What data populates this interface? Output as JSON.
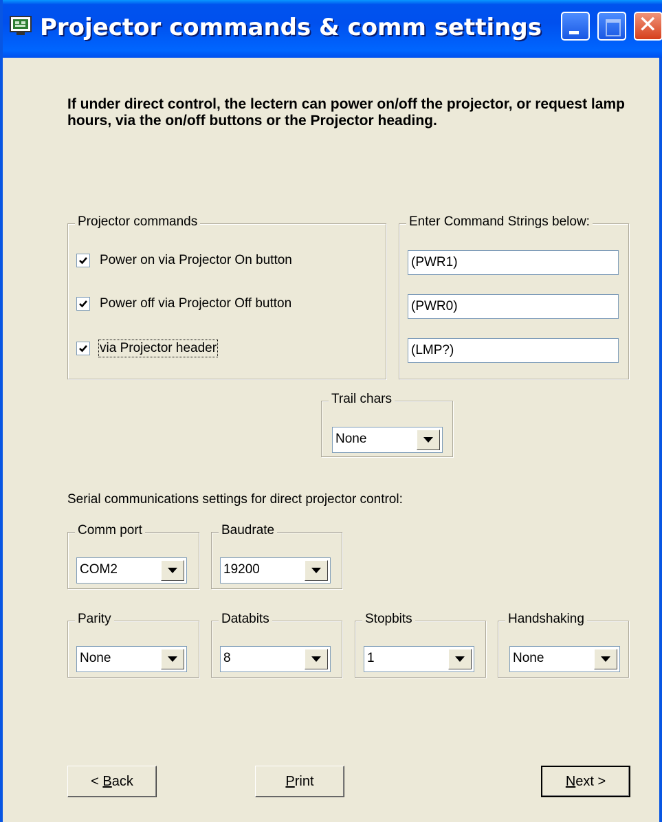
{
  "window": {
    "title": "Projector commands & comm settings",
    "icon": "projector-app-icon",
    "controls": {
      "minimize": "minimize-icon",
      "maximize": "maximize-icon",
      "close": "close-icon"
    }
  },
  "intro_text": "If under direct control, the lectern can power on/off the projector, or request lamp hours, via the on/off buttons or the Projector heading.",
  "projector_commands": {
    "legend": "Projector commands",
    "items": [
      {
        "label": "Power on via Projector On button",
        "checked": true
      },
      {
        "label": "Power off via Projector Off button",
        "checked": true
      },
      {
        "label": "via Projector header",
        "checked": true
      }
    ]
  },
  "command_strings": {
    "legend": "Enter Command Strings below:",
    "values": [
      "(PWR1)",
      "(PWR0)",
      "(LMP?)"
    ]
  },
  "trail_chars": {
    "legend": "Trail chars",
    "value": "None"
  },
  "serial_label": "Serial communications settings for direct projector control:",
  "comm_port": {
    "legend": "Comm port",
    "value": "COM2"
  },
  "baudrate": {
    "legend": "Baudrate",
    "value": "19200"
  },
  "parity": {
    "legend": "Parity",
    "value": "None"
  },
  "databits": {
    "legend": "Databits",
    "value": "8"
  },
  "stopbits": {
    "legend": "Stopbits",
    "value": "1"
  },
  "handshaking": {
    "legend": "Handshaking",
    "value": "None"
  },
  "buttons": {
    "back": {
      "accel": "B",
      "rest": "ack",
      "prefix": "< "
    },
    "print": {
      "accel": "P",
      "rest": "rint"
    },
    "next": {
      "accel": "N",
      "rest": "ext >"
    }
  }
}
